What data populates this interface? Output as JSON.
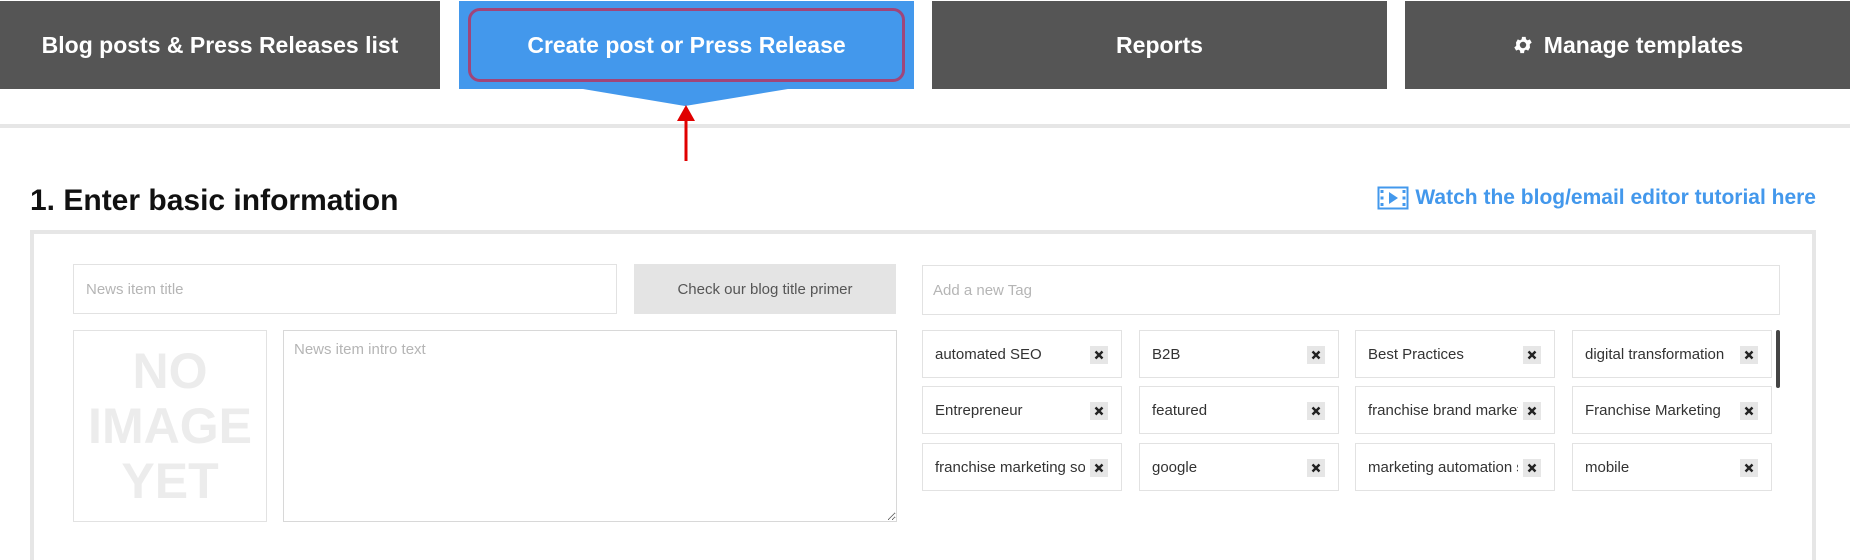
{
  "nav": {
    "tabs": [
      {
        "label": "Blog posts & Press Releases list"
      },
      {
        "label": "Create post or Press Release",
        "active": true
      },
      {
        "label": "Reports"
      },
      {
        "label": "Manage templates",
        "icon": "gear-icon"
      }
    ]
  },
  "section": {
    "heading": "1. Enter basic information",
    "tutorial_link": "Watch the blog/email editor tutorial here",
    "tutorial_icon": "video-icon"
  },
  "form": {
    "title_placeholder": "News item title",
    "title_value": "",
    "primer_button": "Check our blog title primer",
    "tag_placeholder": "Add a new Tag",
    "tag_value": "",
    "no_image_line1": "NO",
    "no_image_line2": "IMAGE",
    "no_image_line3": "YET",
    "intro_placeholder": "News item intro text",
    "intro_value": ""
  },
  "tags": [
    {
      "label": "automated SEO"
    },
    {
      "label": "B2B"
    },
    {
      "label": "Best Practices"
    },
    {
      "label": "digital transformation"
    },
    {
      "label": "Entrepreneur"
    },
    {
      "label": "featured"
    },
    {
      "label": "franchise brand marketing"
    },
    {
      "label": "Franchise Marketing"
    },
    {
      "label": "franchise marketing software"
    },
    {
      "label": "google"
    },
    {
      "label": "marketing automation software"
    },
    {
      "label": "mobile"
    }
  ],
  "colors": {
    "accent": "#4398ec",
    "tab_dark": "#555555",
    "highlight_border": "#a0457a",
    "annotation_arrow": "#e00000"
  }
}
